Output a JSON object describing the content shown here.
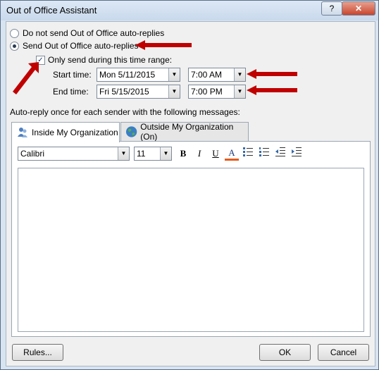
{
  "window": {
    "title": "Out of Office Assistant",
    "help_label": "?",
    "close_label": "✕"
  },
  "options": {
    "no_send": "Do not send Out of Office auto-replies",
    "send": "Send Out of Office auto-replies",
    "time_range": "Only send during this time range:"
  },
  "time": {
    "start_label": "Start time:",
    "start_date": "Mon 5/11/2015",
    "start_time": "7:00 AM",
    "end_label": "End time:",
    "end_date": "Fri 5/15/2015",
    "end_time": "7:00 PM"
  },
  "message_label": "Auto-reply once for each sender with the following messages:",
  "tabs": [
    {
      "label": "Inside My Organization"
    },
    {
      "label": "Outside My Organization (On)"
    }
  ],
  "toolbar": {
    "font": "Calibri",
    "size": "11",
    "bold": "B",
    "italic": "I",
    "underline": "U",
    "font_color": "A"
  },
  "buttons": {
    "rules": "Rules...",
    "ok": "OK",
    "cancel": "Cancel"
  },
  "colors": {
    "arrow": "#c00000",
    "titlebar": "#c9d9ec",
    "close": "#c9452d"
  }
}
